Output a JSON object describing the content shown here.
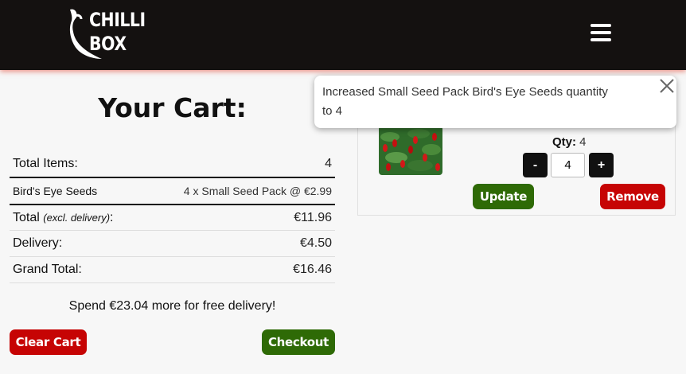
{
  "header": {
    "logo_line1": "CHILLI",
    "logo_line2": "BOX",
    "menu_icon": "hamburger-menu-icon"
  },
  "cart": {
    "title": "Your Cart:",
    "total_items_label": "Total Items:",
    "total_items_value": "4",
    "product_name": "Bird's Eye Seeds",
    "product_detail": "4 x Small Seed Pack @ €2.99",
    "total_label": "Total",
    "total_excl": "(excl. delivery)",
    "total_colon": ":",
    "total_value": "€11.96",
    "delivery_label": "Delivery:",
    "delivery_value": "€4.50",
    "grand_total_label": "Grand Total:",
    "grand_total_value": "€16.46",
    "free_delivery_message": "Spend €23.04 more for free delivery!",
    "clear_button": "Clear Cart",
    "checkout_button": "Checkout"
  },
  "product_card": {
    "qty_label": "Qty:",
    "qty_value": "4",
    "minus_label": "-",
    "plus_label": "+",
    "input_value": "4",
    "update_button": "Update",
    "remove_button": "Remove"
  },
  "toast": {
    "message": "Increased Small Seed Pack Bird's Eye Seeds quantity to 4",
    "close_icon": "close-icon"
  },
  "colors": {
    "header_bg": "#141110",
    "red_button": "#c60404",
    "green_button": "#2e6a06"
  }
}
